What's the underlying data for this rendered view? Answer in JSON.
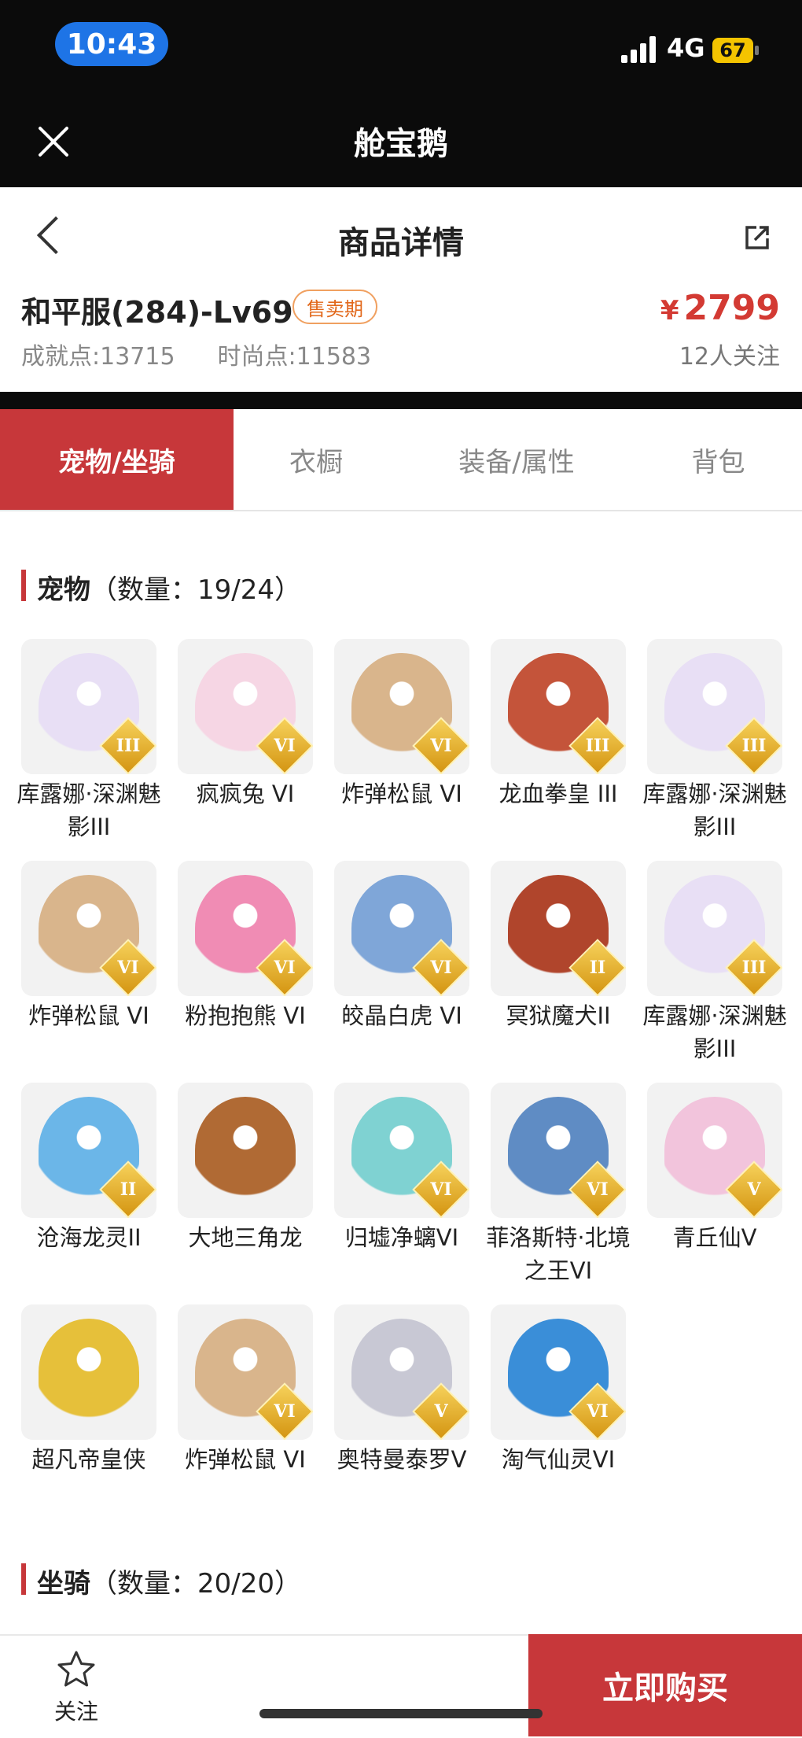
{
  "status": {
    "time": "10:43",
    "network": "4G",
    "battery": "67"
  },
  "app": {
    "title": "舱宝鹅"
  },
  "header": {
    "title": "商品详情"
  },
  "product": {
    "name": "和平服(284)-Lv69",
    "tag": "售卖期",
    "price_symbol": "¥",
    "price": "2799",
    "achievement_label": "成就点:",
    "achievement_value": "13715",
    "fashion_label": "时尚点:",
    "fashion_value": "11583",
    "followers": "12人关注"
  },
  "tabs": [
    {
      "label": "宠物/坐骑",
      "active": true
    },
    {
      "label": "衣橱",
      "active": false
    },
    {
      "label": "装备/属性",
      "active": false
    },
    {
      "label": "背包",
      "active": false
    }
  ],
  "pets_section": {
    "title": "宠物",
    "count": "（数量：19/24）"
  },
  "pets": [
    {
      "name": "库露娜·深渊魅影III",
      "grade": "III",
      "color": "#e8dff5"
    },
    {
      "name": "疯疯兔 VI",
      "grade": "VI",
      "color": "#f6d6e4"
    },
    {
      "name": "炸弹松鼠 VI",
      "grade": "VI",
      "color": "#d9b58c"
    },
    {
      "name": "龙血拳皇 III",
      "grade": "III",
      "color": "#c4543a"
    },
    {
      "name": "库露娜·深渊魅影III",
      "grade": "III",
      "color": "#e8dff5"
    },
    {
      "name": "炸弹松鼠 VI",
      "grade": "VI",
      "color": "#d9b58c"
    },
    {
      "name": "粉抱抱熊 VI",
      "grade": "VI",
      "color": "#f08cb4"
    },
    {
      "name": "皎晶白虎 VI",
      "grade": "VI",
      "color": "#7fa6d8"
    },
    {
      "name": "冥狱魔犬II",
      "grade": "II",
      "color": "#b0452c"
    },
    {
      "name": "库露娜·深渊魅影III",
      "grade": "III",
      "color": "#e8dff5"
    },
    {
      "name": "沧海龙灵II",
      "grade": "II",
      "color": "#6bb6e8"
    },
    {
      "name": "大地三角龙",
      "grade": "",
      "color": "#b06a34"
    },
    {
      "name": "归墟净螭VI",
      "grade": "VI",
      "color": "#7fd2d2"
    },
    {
      "name": "菲洛斯特·北境之王VI",
      "grade": "VI",
      "color": "#5f8cc4"
    },
    {
      "name": "青丘仙V",
      "grade": "V",
      "color": "#f2c4dc"
    },
    {
      "name": "超凡帝皇侠",
      "grade": "",
      "color": "#e6c03a"
    },
    {
      "name": "炸弹松鼠 VI",
      "grade": "VI",
      "color": "#d9b58c"
    },
    {
      "name": "奥特曼泰罗V",
      "grade": "V",
      "color": "#c8c8d4"
    },
    {
      "name": "淘气仙灵VI",
      "grade": "VI",
      "color": "#3a8ed8"
    }
  ],
  "mounts_section": {
    "title": "坐骑",
    "count": "（数量：20/20）"
  },
  "bottom": {
    "follow_label": "关注",
    "buy_label": "立即购买"
  },
  "colors": {
    "accent": "#c7373a",
    "price": "#d33a33"
  }
}
